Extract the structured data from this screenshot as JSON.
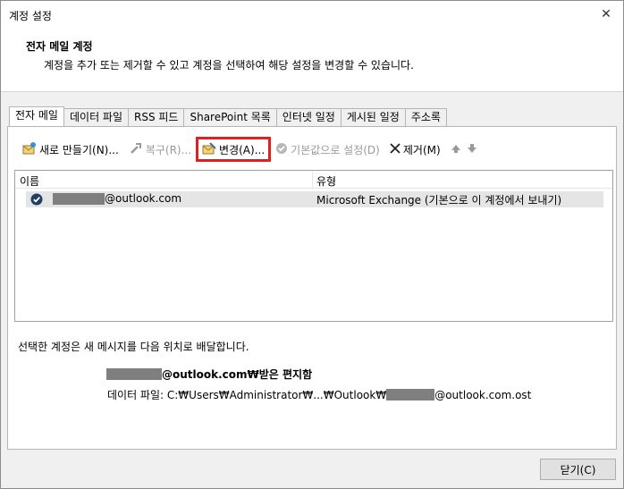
{
  "window": {
    "title": "계정 설정",
    "close_glyph": "✕"
  },
  "header": {
    "title": "전자 메일 계정",
    "description": "계정을 추가 또는 제거할 수 있고 계정을 선택하여 해당 설정을 변경할 수 있습니다."
  },
  "tabs": [
    {
      "label": "전자 메일",
      "active": true
    },
    {
      "label": "데이터 파일"
    },
    {
      "label": "RSS 피드"
    },
    {
      "label": "SharePoint 목록"
    },
    {
      "label": "인터넷 일정"
    },
    {
      "label": "게시된 일정"
    },
    {
      "label": "주소록"
    }
  ],
  "toolbar": {
    "new": "새로 만들기(N)...",
    "repair": "복구(R)...",
    "change": "변경(A)...",
    "set_default": "기본값으로 설정(D)",
    "remove": "제거(M)"
  },
  "list": {
    "columns": {
      "name": "이름",
      "type": "유형"
    },
    "rows": [
      {
        "name_suffix": "@outlook.com",
        "type": "Microsoft Exchange (기본으로 이 계정에서 보내기)"
      }
    ]
  },
  "delivery": {
    "label": "선택한 계정은 새 메시지를 다음 위치로 배달합니다.",
    "inbox_suffix": "@outlook.com₩받은 편지함",
    "datafile_prefix": "데이터 파일: C:₩Users₩Administrator₩...₩Outlook₩",
    "datafile_suffix": "@outlook.com.ost"
  },
  "footer": {
    "close_label": "닫기(C)"
  },
  "colors": {
    "highlight": "#e0201f",
    "selected_row": "#e5e5e5",
    "redaction": "#7f7f7f"
  }
}
